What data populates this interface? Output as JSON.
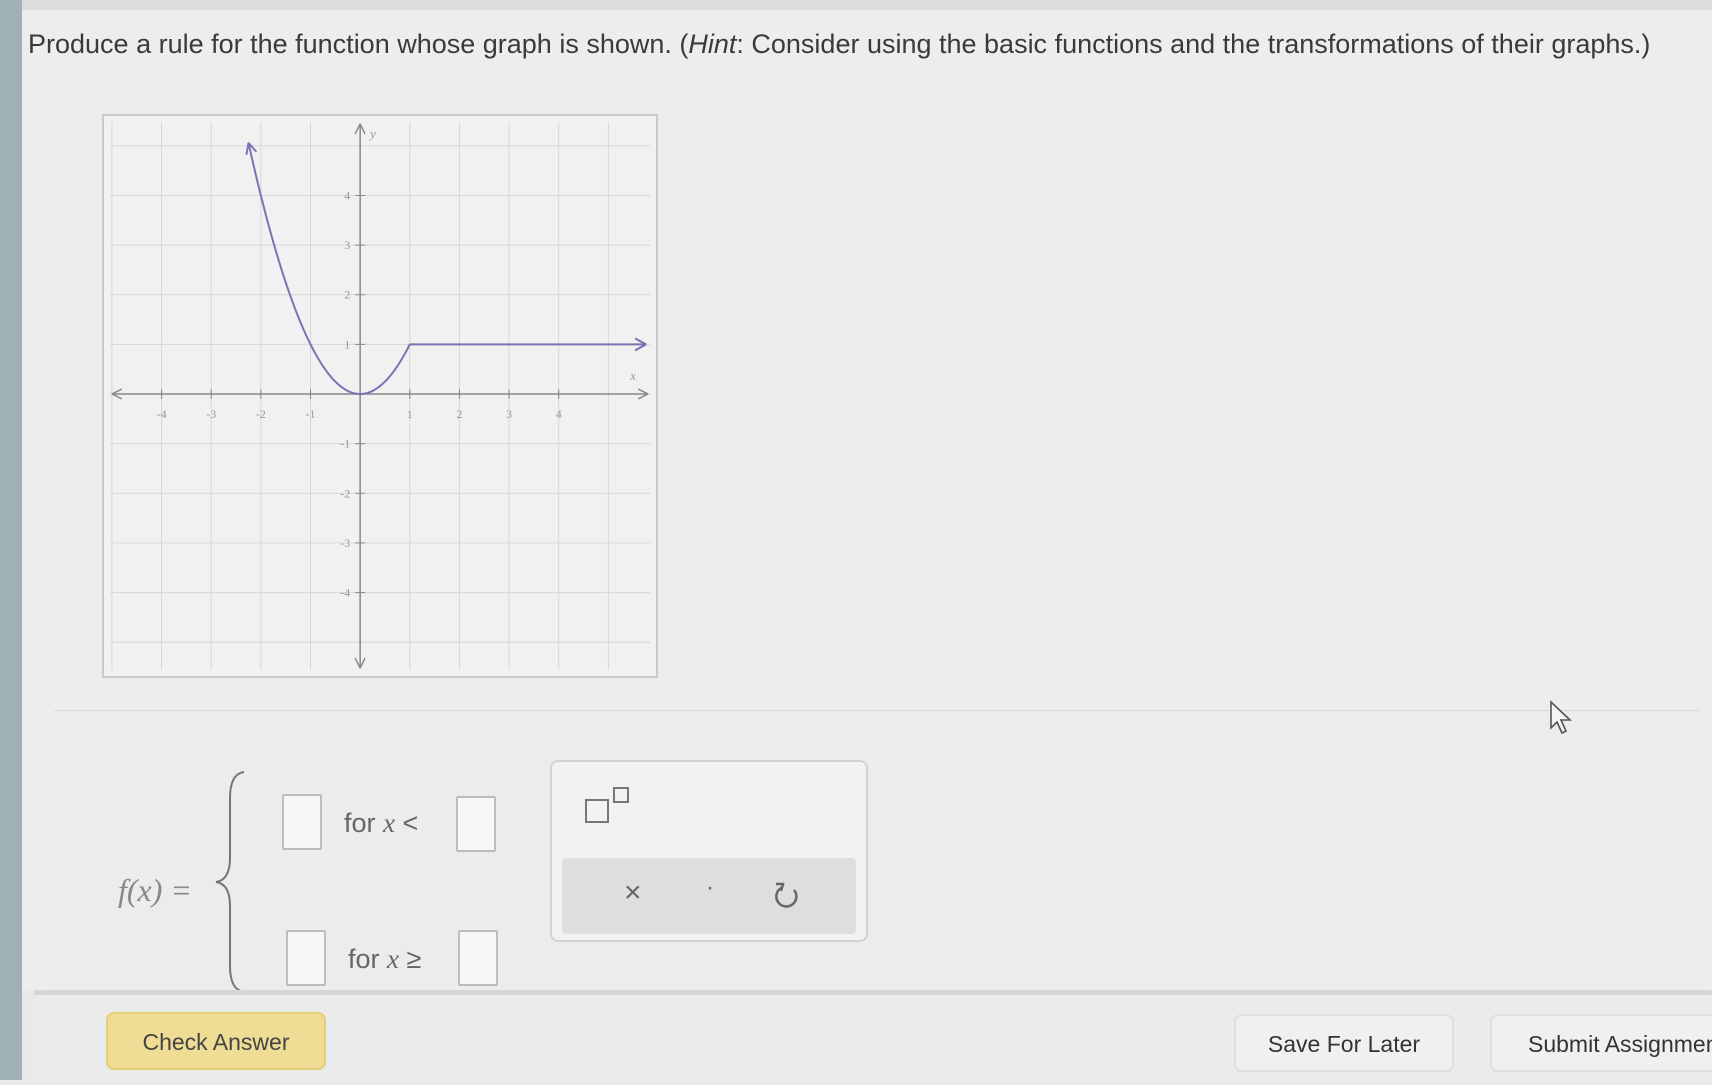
{
  "question": {
    "text_before_hint": "Produce a rule for the function whose graph is shown. (",
    "hint_label": "Hint",
    "text_after_hint": ": Consider using the basic functions and the transformations of their graphs.)"
  },
  "graph": {
    "x_ticks": [
      "-4",
      "-3",
      "-2",
      "-1",
      "1",
      "2",
      "3",
      "4"
    ],
    "y_ticks": [
      "4",
      "3",
      "2",
      "1",
      "-1",
      "-2",
      "-3",
      "-4"
    ],
    "x_axis_label": "x",
    "y_axis_label": "y",
    "curve_color": "#7a73b3",
    "curve_description_points": {
      "parabola": [
        [
          -2.3,
          5.1
        ],
        [
          -2,
          4
        ],
        [
          -1,
          1
        ],
        [
          0,
          0
        ],
        [
          0.5,
          0.25
        ],
        [
          1,
          1
        ]
      ],
      "horizontal": [
        [
          1,
          1
        ],
        [
          5,
          1
        ]
      ]
    }
  },
  "answer": {
    "function_label": "f(x) =",
    "row1_for": "for ",
    "row1_var": "x",
    "row1_op": " <",
    "row2_for": "for ",
    "row2_var": "x",
    "row2_op": " ≥"
  },
  "palette": {
    "exponent_icon": "exponent-icon",
    "clear_symbol": "×",
    "dot_symbol": "·",
    "undo_icon": "undo-icon"
  },
  "buttons": {
    "check_answer": "Check Answer",
    "save_for_later": "Save For Later",
    "submit_assignment": "Submit Assignmen"
  },
  "colors": {
    "check_button": "#efdd95",
    "background": "#ededed"
  }
}
